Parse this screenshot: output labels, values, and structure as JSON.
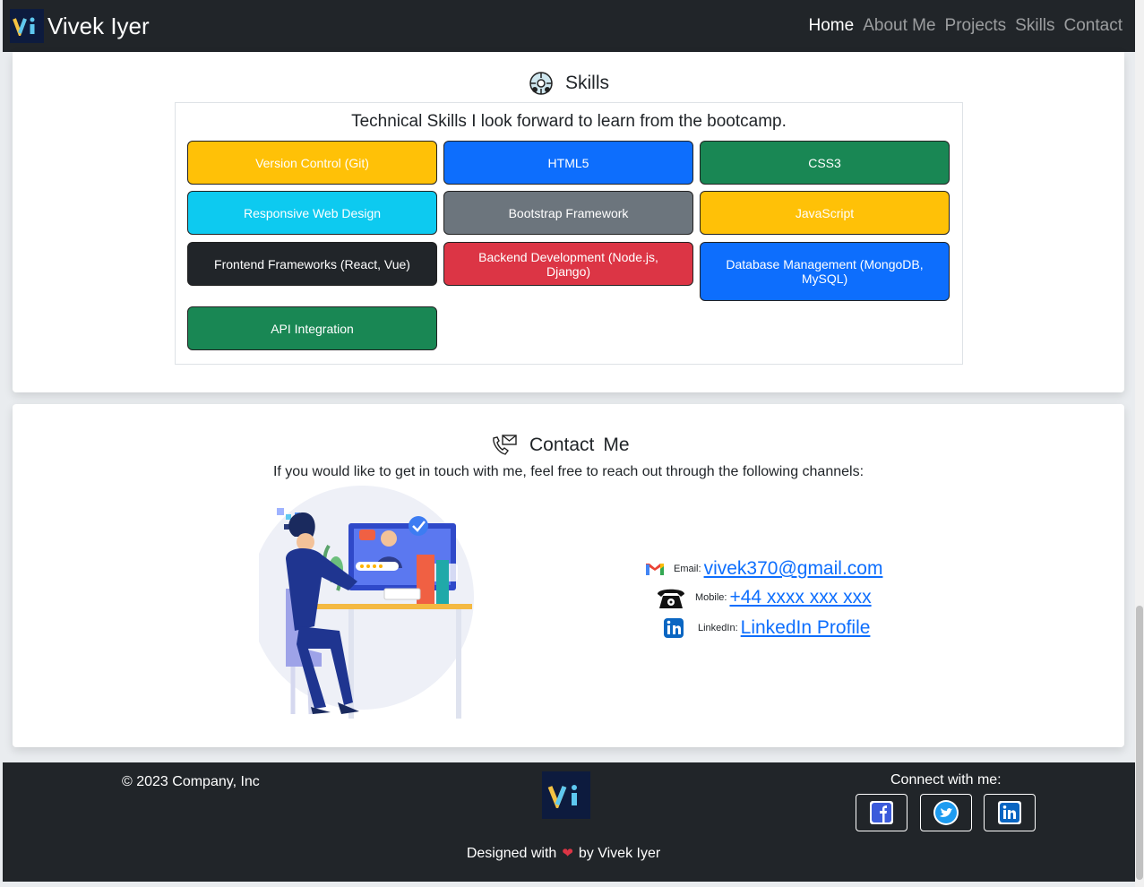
{
  "nav": {
    "brand": "Vivek Iyer",
    "logo_text": "Vi",
    "links": [
      {
        "label": "Home",
        "active": true
      },
      {
        "label": "About Me",
        "active": false
      },
      {
        "label": "Projects",
        "active": false
      },
      {
        "label": "Skills",
        "active": false
      },
      {
        "label": "Contact",
        "active": false
      }
    ]
  },
  "skills": {
    "title": "Skills",
    "subtitle": "Technical Skills I look forward to learn from the bootcamp.",
    "items": [
      {
        "label": "Version Control (Git)",
        "color": "#ffc107"
      },
      {
        "label": "HTML5",
        "color": "#0d6efd"
      },
      {
        "label": "CSS3",
        "color": "#198754"
      },
      {
        "label": "Responsive Web Design",
        "color": "#0dcaf0"
      },
      {
        "label": "Bootstrap Framework",
        "color": "#6c757d"
      },
      {
        "label": "JavaScript",
        "color": "#ffc107"
      },
      {
        "label": "Frontend Frameworks (React, Vue)",
        "color": "#212529"
      },
      {
        "label": "Backend Development (Node.js, Django)",
        "color": "#dc3545"
      },
      {
        "label": "Database Management (MongoDB, MySQL)",
        "color": "#0d6efd"
      },
      {
        "label": "API Integration",
        "color": "#198754"
      }
    ]
  },
  "contact": {
    "title_word1": "Contact",
    "title_word2": "Me",
    "intro": "If you would like to get in touch with me, feel free to reach out through the following channels:",
    "email_label": "Email:",
    "email_value": "vivek370@gmail.com",
    "mobile_label": "Mobile:",
    "mobile_value": "+44 xxxx xxx xxx",
    "linkedin_label": "LinkedIn:",
    "linkedin_value": "LinkedIn Profile"
  },
  "footer": {
    "copyright": "© 2023 Company, Inc",
    "connect": "Connect with me:",
    "designed_prefix": "Designed with",
    "designed_suffix": "by Vivek Iyer",
    "social_icons": [
      "facebook-icon",
      "twitter-icon",
      "linkedin-icon"
    ]
  }
}
